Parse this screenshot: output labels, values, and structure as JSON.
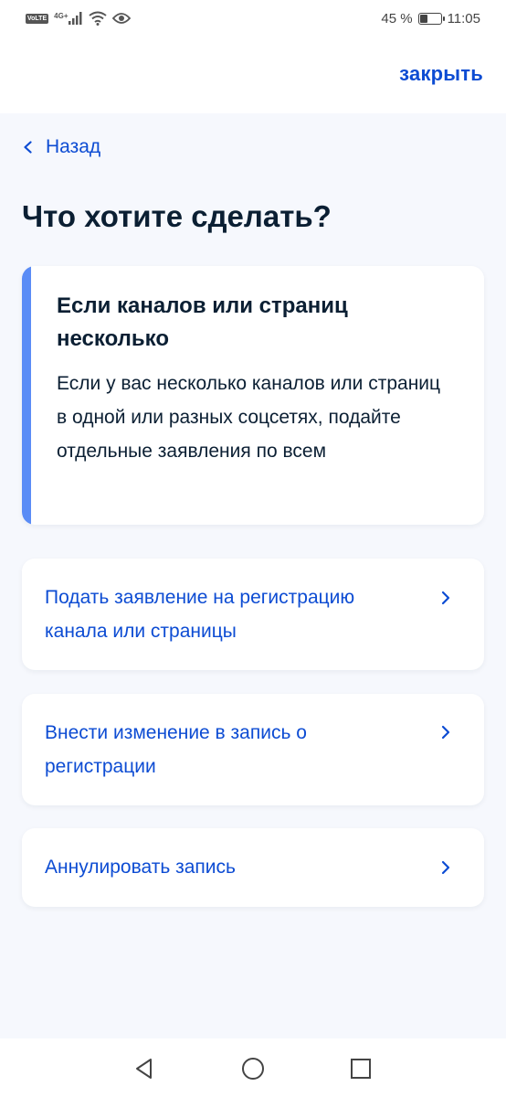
{
  "status_bar": {
    "volte": "VoLTE",
    "network": "4G+",
    "battery_percent": "45 %",
    "battery_level": 0.45,
    "time": "11:05"
  },
  "header": {
    "close_label": "закрыть"
  },
  "nav": {
    "back_label": "Назад"
  },
  "page": {
    "title": "Что хотите сделать?"
  },
  "info": {
    "title": "Если каналов или страниц несколько",
    "text": "Если у вас несколько каналов или страниц в одной или разных соцсетях, подайте отдельные заявления по всем"
  },
  "options": [
    {
      "label": "Подать заявление на регистрацию канала или страницы"
    },
    {
      "label": "Внести изменение в запись о регистрации"
    },
    {
      "label": "Аннулировать запись"
    }
  ],
  "colors": {
    "accent": "#0D4CD3",
    "info_bar": "#5A8CF6",
    "background": "#F6F8FD",
    "text": "#0B1F33"
  }
}
